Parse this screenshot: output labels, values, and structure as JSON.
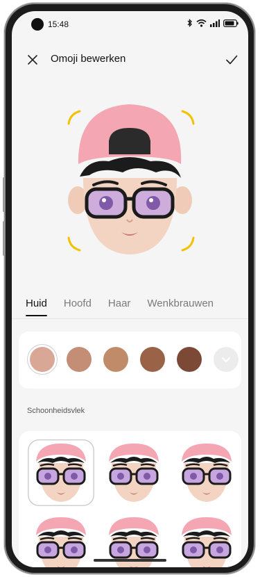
{
  "status_bar": {
    "time": "15:48"
  },
  "header": {
    "title": "Omoji bewerken"
  },
  "tabs": [
    {
      "label": "Huid",
      "active": true
    },
    {
      "label": "Hoofd",
      "active": false
    },
    {
      "label": "Haar",
      "active": false
    },
    {
      "label": "Wenkbrauwen",
      "active": false
    }
  ],
  "skin_colors": {
    "swatches": [
      "#d9a796",
      "#c48d76",
      "#c08b68",
      "#9a6347",
      "#7c4937"
    ],
    "selected_index": 0
  },
  "section": {
    "label": "Schoonheidsvlek"
  },
  "colors": {
    "accent": "#f2c200",
    "cap": "#f4a6b3",
    "glasses_lens": "#c7a6e0",
    "skin": "#f3d3c2"
  },
  "presets": {
    "count": 6,
    "selected_index": 0
  }
}
